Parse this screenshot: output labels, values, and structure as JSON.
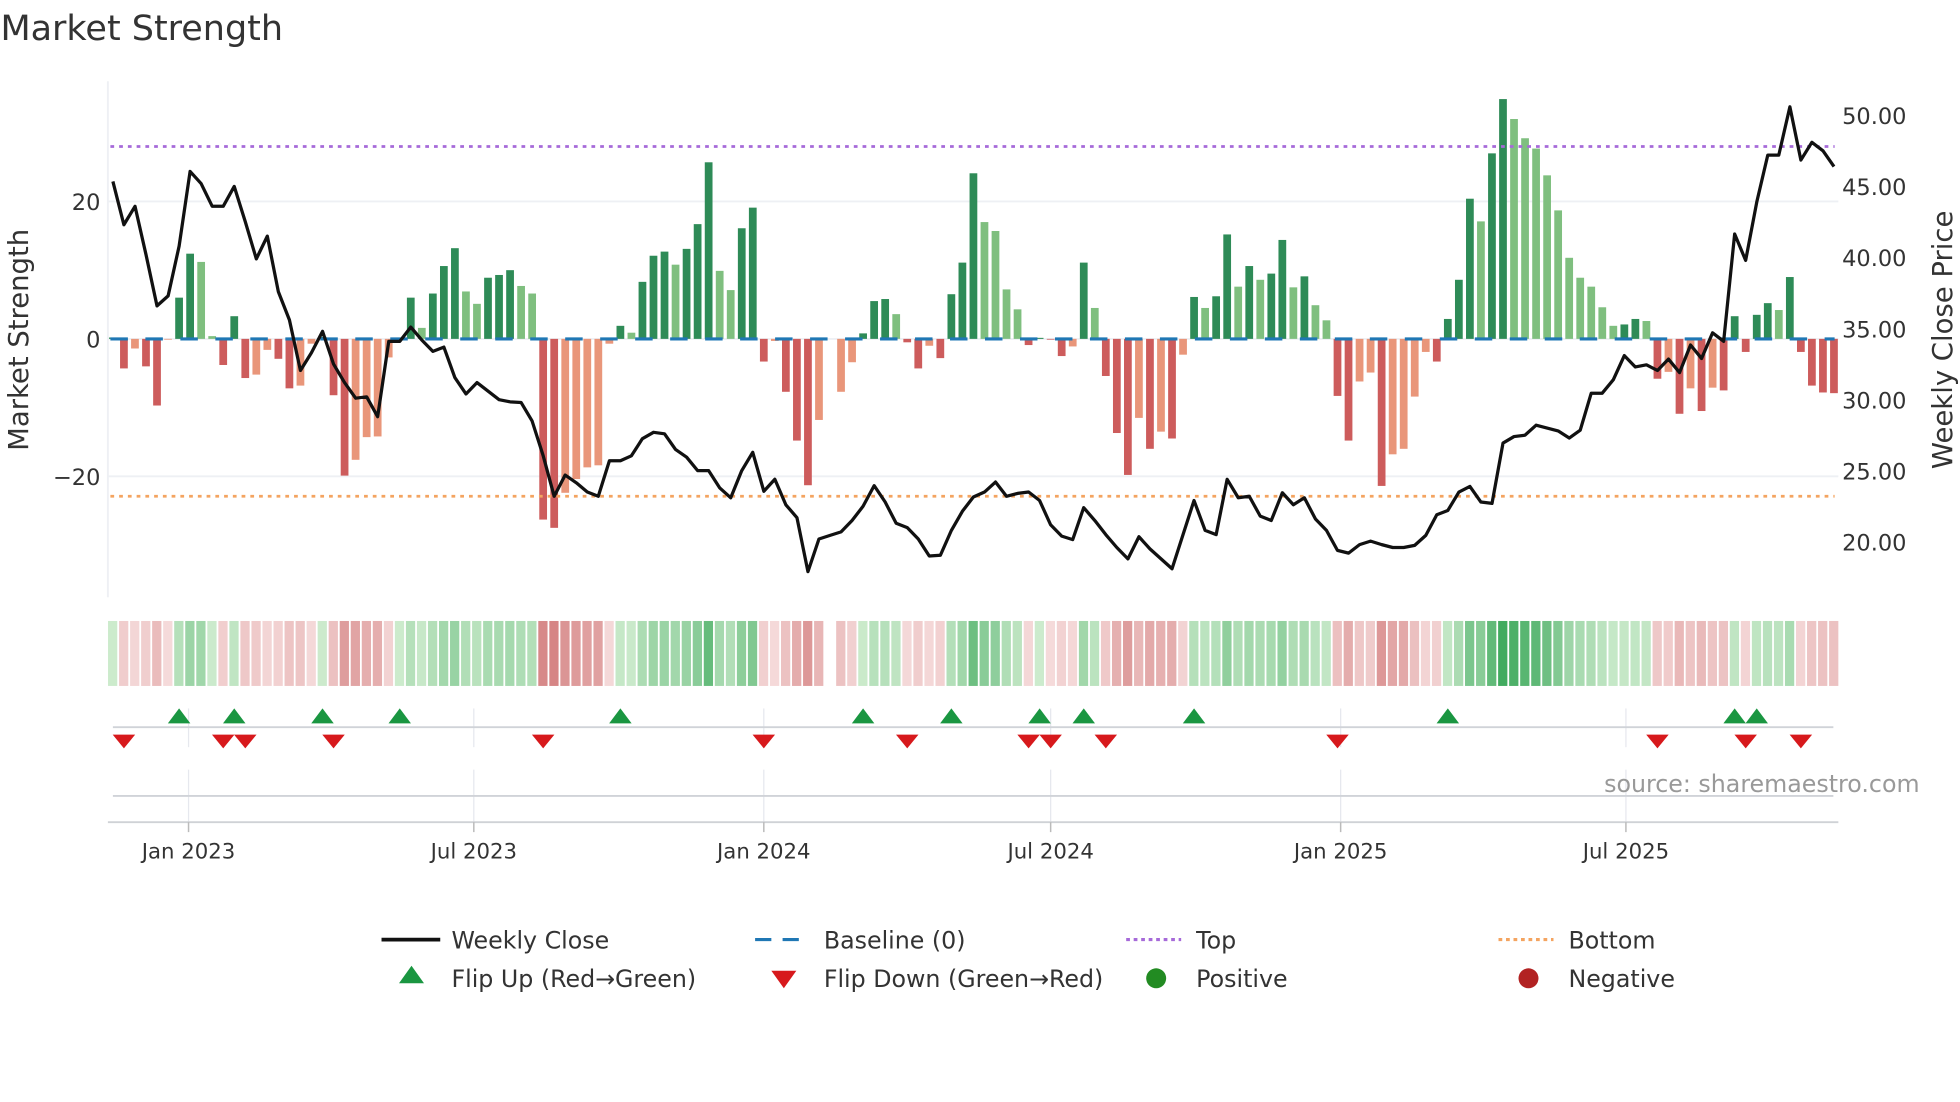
{
  "chart_data": {
    "type": "bar",
    "title": "Market Strength",
    "ylabel": "Market Strength",
    "y2label": "Weekly Close Price",
    "ylim": [
      -37.6,
      37.5
    ],
    "y2lim": [
      16.1,
      52.4
    ],
    "yticks": [
      {
        "value": 20,
        "label": "20"
      },
      {
        "value": 0,
        "label": "0"
      },
      {
        "value": -20,
        "label": "−20"
      }
    ],
    "y2ticks": [
      {
        "value": 50,
        "label": "50.00"
      },
      {
        "value": 45,
        "label": "45.00"
      },
      {
        "value": 40,
        "label": "40.00"
      },
      {
        "value": 35,
        "label": "35.00"
      },
      {
        "value": 30,
        "label": "30.00"
      },
      {
        "value": 25,
        "label": "25.00"
      },
      {
        "value": 20,
        "label": "20.00"
      }
    ],
    "xticks": [
      {
        "date": "2023-01-01",
        "label": "Jan 2023"
      },
      {
        "date": "2023-07-01",
        "label": "Jul 2023"
      },
      {
        "date": "2024-01-01",
        "label": "Jan 2024"
      },
      {
        "date": "2024-07-01",
        "label": "Jul 2024"
      },
      {
        "date": "2025-01-01",
        "label": "Jan 2025"
      },
      {
        "date": "2025-07-01",
        "label": "Jul 2025"
      }
    ],
    "start_week": "2022-11-14",
    "interval_days": 7,
    "top_level": 28,
    "bottom_level": -22.9,
    "baseline": 0,
    "strength": [
      0.2,
      -4.3,
      -1.4,
      -4.0,
      -9.7,
      -0.1,
      6.0,
      12.4,
      11.2,
      0.4,
      -3.8,
      3.3,
      -5.7,
      -5.2,
      -1.6,
      -2.9,
      -7.2,
      -6.8,
      -0.7,
      0.3,
      -8.2,
      -19.9,
      -17.6,
      -14.3,
      -14.2,
      -2.7,
      0.2,
      6.0,
      1.6,
      6.6,
      10.6,
      13.2,
      6.9,
      5.1,
      8.9,
      9.3,
      10.0,
      7.7,
      6.6,
      -26.3,
      -27.5,
      -22.4,
      -20.4,
      -18.7,
      -18.4,
      -0.7,
      1.9,
      0.9,
      8.3,
      12.1,
      12.7,
      10.8,
      13.1,
      16.7,
      25.7,
      9.9,
      7.1,
      16.1,
      19.1,
      -3.3,
      -0.3,
      -7.7,
      -14.8,
      -21.3,
      -11.8,
      null,
      -7.7,
      -3.4,
      0.8,
      5.5,
      5.8,
      3.6,
      -0.5,
      -4.3,
      -1.0,
      -2.8,
      6.5,
      11.1,
      24.1,
      17.0,
      15.7,
      7.2,
      4.3,
      -0.9,
      0.15,
      -0.1,
      -2.5,
      -1.1,
      11.1,
      4.5,
      -5.4,
      -13.7,
      -19.8,
      -11.5,
      -16.0,
      -13.5,
      -14.5,
      -2.3,
      6.1,
      4.5,
      6.2,
      15.2,
      7.6,
      10.6,
      8.6,
      9.5,
      14.4,
      7.5,
      9.1,
      4.9,
      2.7,
      -8.3,
      -14.8,
      -6.2,
      -4.9,
      -21.4,
      -16.8,
      -16.0,
      -8.4,
      -1.9,
      -3.3,
      2.9,
      8.6,
      20.4,
      17.1,
      27.0,
      34.9,
      32.0,
      29.2,
      27.7,
      23.8,
      18.7,
      11.8,
      8.9,
      7.6,
      4.6,
      1.9,
      2.1,
      2.9,
      2.6,
      -5.8,
      -4.8,
      -10.9,
      -7.2,
      -10.5,
      -7.1,
      -7.5,
      3.3,
      -1.9,
      3.5,
      5.2,
      4.2,
      9.0,
      -1.9,
      -6.8,
      -7.8,
      -7.9
    ],
    "weekly_close": [
      45.35,
      42.3,
      43.6,
      40.2,
      36.6,
      37.3,
      40.8,
      46.05,
      45.2,
      43.6,
      43.6,
      45.0,
      42.5,
      39.9,
      41.5,
      37.6,
      35.6,
      32.05,
      33.3,
      34.8,
      32.5,
      31.2,
      30.1,
      30.2,
      28.8,
      34.1,
      34.1,
      35.1,
      34.2,
      33.4,
      33.7,
      31.55,
      30.4,
      31.2,
      30.6,
      30.0,
      29.85,
      29.8,
      28.5,
      26.05,
      23.2,
      24.7,
      24.15,
      23.5,
      23.2,
      25.7,
      25.7,
      26.05,
      27.25,
      27.7,
      27.6,
      26.5,
      25.95,
      25.0,
      25.0,
      23.8,
      23.1,
      25.0,
      26.3,
      23.55,
      24.4,
      22.6,
      21.7,
      17.9,
      20.2,
      20.45,
      20.7,
      21.5,
      22.5,
      23.95,
      22.8,
      21.3,
      21.0,
      20.2,
      19.0,
      19.05,
      20.8,
      22.15,
      23.15,
      23.5,
      24.2,
      23.2,
      23.4,
      23.5,
      22.9,
      21.2,
      20.4,
      20.15,
      22.4,
      21.5,
      20.5,
      19.6,
      18.8,
      20.35,
      19.5,
      18.8,
      18.1,
      20.5,
      22.9,
      20.8,
      20.5,
      24.4,
      23.1,
      23.2,
      21.8,
      21.5,
      23.45,
      22.6,
      23.1,
      21.6,
      20.8,
      19.4,
      19.2,
      19.8,
      20.05,
      19.8,
      19.6,
      19.6,
      19.75,
      20.45,
      21.9,
      22.2,
      23.5,
      23.9,
      22.8,
      22.7,
      26.95,
      27.4,
      27.5,
      28.2,
      28.0,
      27.8,
      27.3,
      27.85,
      30.45,
      30.45,
      31.4,
      33.1,
      32.3,
      32.45,
      32.05,
      32.85,
      31.9,
      33.85,
      32.9,
      34.7,
      34.1,
      41.65,
      39.8,
      43.9,
      47.2,
      47.2,
      50.6,
      46.85,
      48.1,
      47.5,
      46.4
    ],
    "flip_up": [
      6,
      11,
      19,
      26,
      46,
      68,
      76,
      84,
      88,
      98,
      121,
      147,
      149
    ],
    "flip_down": [
      1,
      10,
      12,
      20,
      39,
      59,
      72,
      83,
      85,
      90,
      111,
      140,
      148,
      153
    ],
    "legend": {
      "placement": "bottom",
      "items": [
        {
          "key": "close",
          "label": "Weekly Close"
        },
        {
          "key": "baseline",
          "label": "Baseline (0)"
        },
        {
          "key": "top",
          "label": "Top"
        },
        {
          "key": "bottom",
          "label": "Bottom"
        },
        {
          "key": "flip_up",
          "label": "Flip Up (Red→Green)"
        },
        {
          "key": "flip_down",
          "label": "Flip Down (Green→Red)"
        },
        {
          "key": "positive",
          "label": "Positive"
        },
        {
          "key": "negative",
          "label": "Negative"
        }
      ]
    },
    "annotation": "source: sharemaestro.com"
  },
  "colors": {
    "pos_rising": "#2e8b57",
    "pos_falling": "#7fbf7f",
    "neg_falling": "#cd5c5c",
    "neg_rising": "#e9967a",
    "close": "#111111",
    "baseline": "#1f77b4",
    "top": "#a66ad9",
    "bottom": "#f4a460",
    "flip_up": "#1a9641",
    "flip_down": "#d7191c",
    "positive": "#228b22",
    "negative": "#b22222"
  }
}
